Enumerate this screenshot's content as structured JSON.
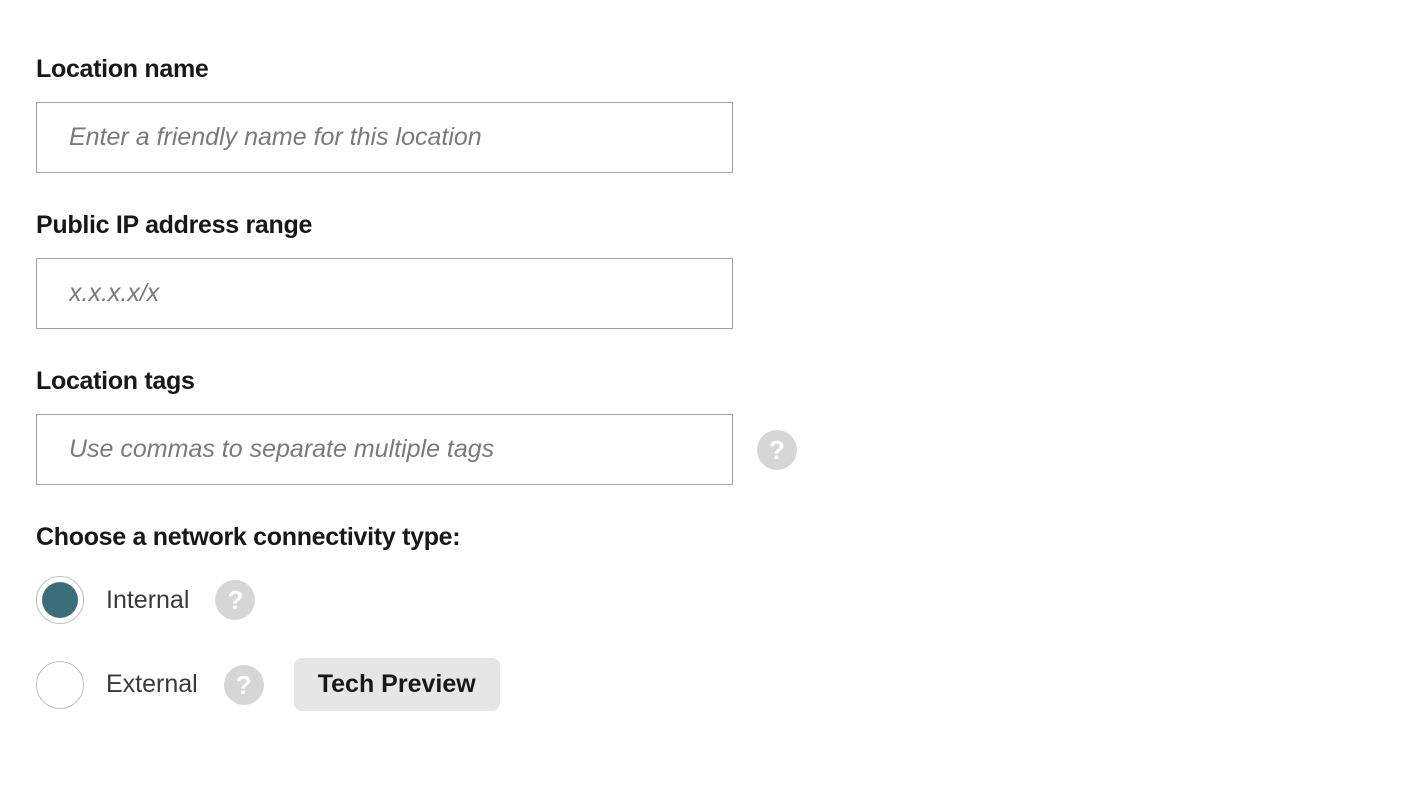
{
  "form": {
    "location_name": {
      "label": "Location name",
      "placeholder": "Enter a friendly name for this location",
      "value": ""
    },
    "public_ip": {
      "label": "Public IP address range",
      "placeholder": "x.x.x.x/x",
      "value": ""
    },
    "location_tags": {
      "label": "Location tags",
      "placeholder": "Use commas to separate multiple tags",
      "value": ""
    },
    "connectivity": {
      "label": "Choose a network connectivity type:",
      "options": {
        "internal": {
          "label": "Internal",
          "selected": true
        },
        "external": {
          "label": "External",
          "selected": false,
          "badge": "Tech Preview"
        }
      }
    }
  },
  "icons": {
    "help": "?"
  }
}
